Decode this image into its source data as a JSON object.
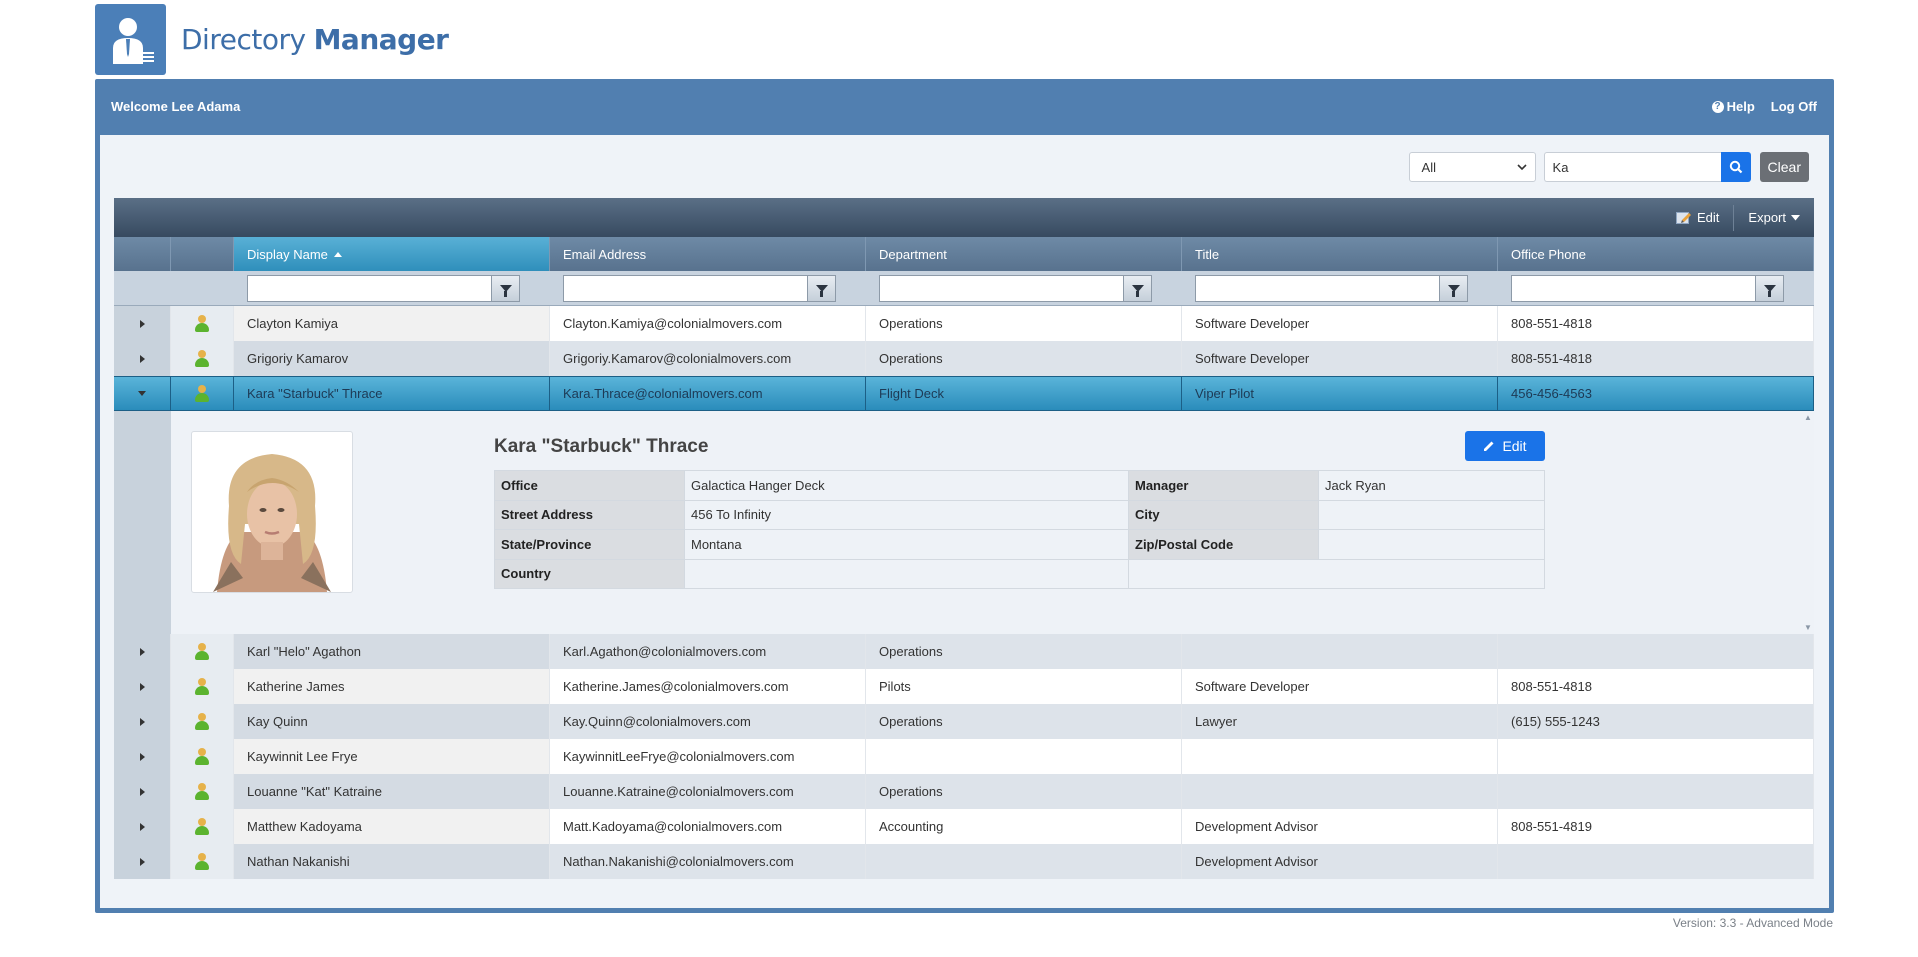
{
  "app": {
    "title_light": "Directory",
    "title_bold": "Manager"
  },
  "header": {
    "welcome": "Welcome Lee Adama",
    "help_label": "Help",
    "logoff_label": "Log Off"
  },
  "search": {
    "scope_value": "All",
    "query_value": "Ka",
    "clear_label": "Clear"
  },
  "toolbar": {
    "edit_label": "Edit",
    "export_label": "Export"
  },
  "columns": [
    "Display Name",
    "Email Address",
    "Department",
    "Title",
    "Office Phone"
  ],
  "rows_before": [
    {
      "name": "Clayton Kamiya",
      "email": "Clayton.Kamiya@colonialmovers.com",
      "dept": "Operations",
      "title": "Software Developer",
      "phone": "808-551-4818"
    },
    {
      "name": "Grigoriy Kamarov",
      "email": "Grigoriy.Kamarov@colonialmovers.com",
      "dept": "Operations",
      "title": "Software Developer",
      "phone": "808-551-4818"
    }
  ],
  "selected": {
    "name": "Kara \"Starbuck\" Thrace",
    "email": "Kara.Thrace@colonialmovers.com",
    "dept": "Flight Deck",
    "title": "Viper Pilot",
    "phone": "456-456-4563"
  },
  "detail": {
    "display_name": "Kara \"Starbuck\" Thrace",
    "edit_label": "Edit",
    "office_label": "Office",
    "office": "Galactica Hanger Deck",
    "manager_label": "Manager",
    "manager": "Jack Ryan",
    "street_label": "Street Address",
    "street": "456 To Infinity",
    "city_label": "City",
    "city": "",
    "state_label": "State/Province",
    "state": "Montana",
    "zip_label": "Zip/Postal Code",
    "zip": "",
    "country_label": "Country",
    "country": ""
  },
  "rows_after": [
    {
      "name": "Karl \"Helo\" Agathon",
      "email": "Karl.Agathon@colonialmovers.com",
      "dept": "Operations",
      "title": "",
      "phone": ""
    },
    {
      "name": "Katherine James",
      "email": "Katherine.James@colonialmovers.com",
      "dept": "Pilots",
      "title": "Software Developer",
      "phone": "808-551-4818"
    },
    {
      "name": "Kay Quinn",
      "email": "Kay.Quinn@colonialmovers.com",
      "dept": "Operations",
      "title": "Lawyer",
      "phone": "(615) 555-1243"
    },
    {
      "name": "Kaywinnit Lee Frye",
      "email": "KaywinnitLeeFrye@colonialmovers.com",
      "dept": "",
      "title": "",
      "phone": ""
    },
    {
      "name": "Louanne \"Kat\" Katraine",
      "email": "Louanne.Katraine@colonialmovers.com",
      "dept": "Operations",
      "title": "",
      "phone": ""
    },
    {
      "name": "Matthew Kadoyama",
      "email": "Matt.Kadoyama@colonialmovers.com",
      "dept": "Accounting",
      "title": "Development Advisor",
      "phone": "808-551-4819"
    },
    {
      "name": "Nathan Nakanishi",
      "email": "Nathan.Nakanishi@colonialmovers.com",
      "dept": "",
      "title": "Development Advisor",
      "phone": ""
    }
  ],
  "footer": {
    "version": "Version: 3.3 - Advanced Mode"
  },
  "colors": {
    "frame": "#517fb0",
    "accent": "#1a73e8",
    "selected_row": "#2a8cbb"
  },
  "icons": {
    "logo": "user-directory-icon",
    "help": "question-circle-icon",
    "search": "search-icon",
    "filter": "funnel-icon",
    "person": "user-icon",
    "edit": "pencil-icon",
    "export": "caret-down-icon"
  }
}
